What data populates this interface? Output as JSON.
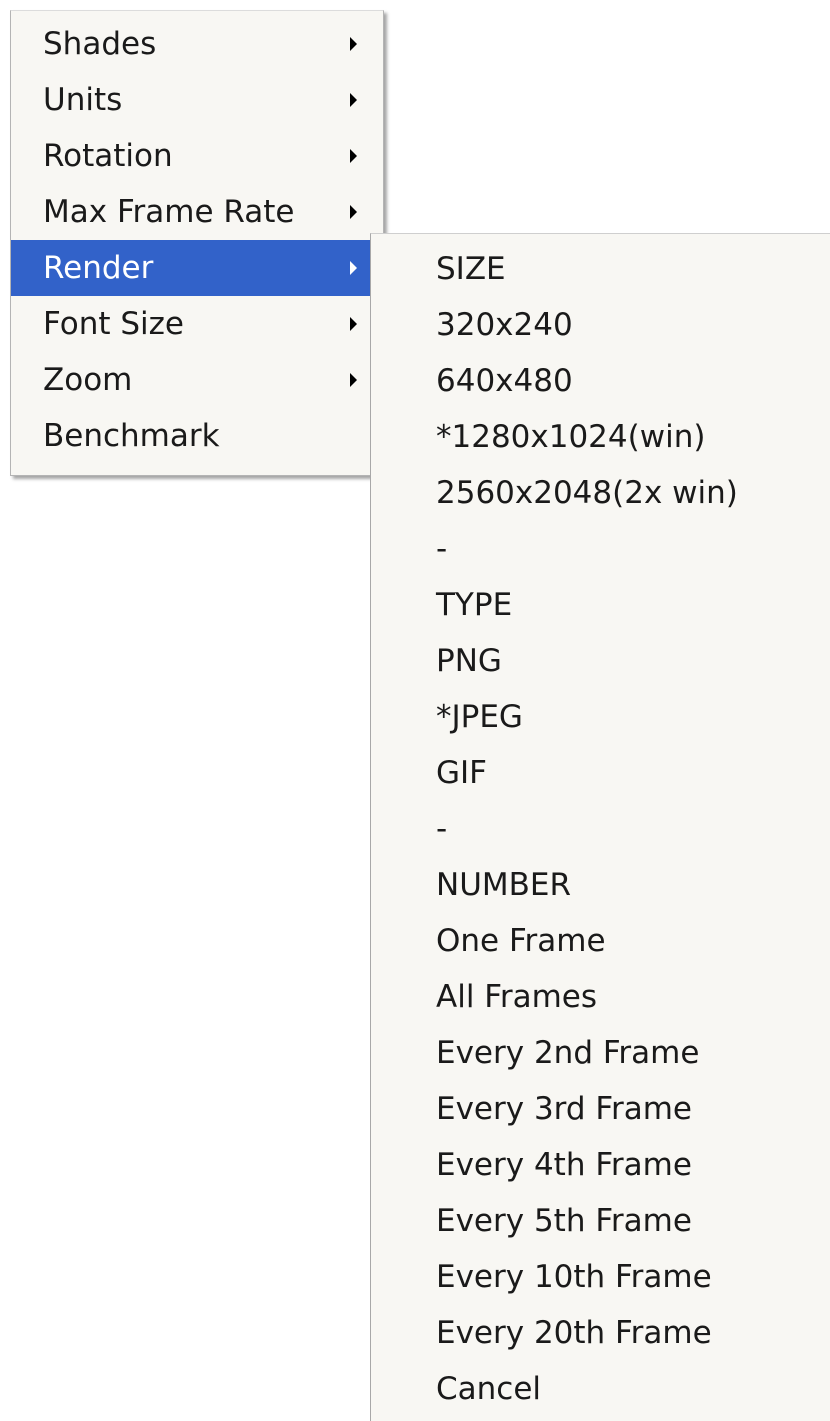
{
  "main_menu": {
    "items": [
      {
        "label": "Shades",
        "has_submenu": true
      },
      {
        "label": "Units",
        "has_submenu": true
      },
      {
        "label": "Rotation",
        "has_submenu": true
      },
      {
        "label": "Max Frame Rate",
        "has_submenu": true
      },
      {
        "label": "Render",
        "has_submenu": true,
        "highlighted": true
      },
      {
        "label": "Font Size",
        "has_submenu": true
      },
      {
        "label": "Zoom",
        "has_submenu": true
      },
      {
        "label": "Benchmark",
        "has_submenu": false
      }
    ],
    "highlight_color": "#3262c9"
  },
  "render_submenu": {
    "items": [
      {
        "label": "SIZE"
      },
      {
        "label": "320x240"
      },
      {
        "label": "640x480"
      },
      {
        "label": "*1280x1024(win)"
      },
      {
        "label": "2560x2048(2x win)"
      },
      {
        "label": "-"
      },
      {
        "label": "TYPE"
      },
      {
        "label": "PNG"
      },
      {
        "label": "*JPEG"
      },
      {
        "label": "GIF"
      },
      {
        "label": "-"
      },
      {
        "label": "NUMBER"
      },
      {
        "label": "One Frame"
      },
      {
        "label": "All Frames"
      },
      {
        "label": "Every 2nd Frame"
      },
      {
        "label": "Every 3rd Frame"
      },
      {
        "label": "Every 4th Frame"
      },
      {
        "label": "Every 5th Frame"
      },
      {
        "label": "Every 10th Frame"
      },
      {
        "label": "Every 20th Frame"
      },
      {
        "label": "Cancel"
      }
    ]
  }
}
